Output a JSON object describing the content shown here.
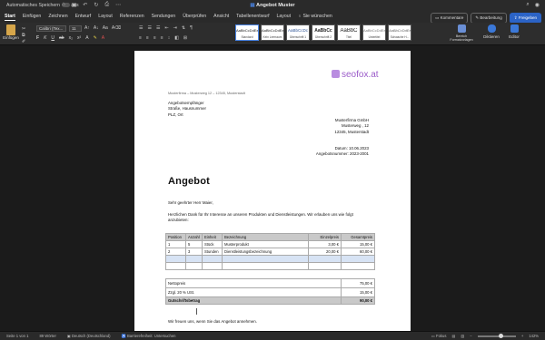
{
  "titlebar": {
    "autosave_label": "Automatisches Speichern",
    "autosave_state": "aus",
    "doc_title": "Angebot Muster",
    "dot_colors": [
      "#ff5f57",
      "#febc2e",
      "#28c840"
    ]
  },
  "tabs": [
    "Start",
    "Einfügen",
    "Zeichnen",
    "Entwurf",
    "Layout",
    "Referenzen",
    "Sendungen",
    "Überprüfen",
    "Ansicht",
    "Tabellenentwurf",
    "Layout",
    "Sie wünschen"
  ],
  "actions": {
    "comments": "Kommentare",
    "editing": "Bearbeitung",
    "share": "Freigeben"
  },
  "ribbon": {
    "paste": "Einfügen",
    "font": "Calibri (Tex...",
    "size": "11",
    "styles": [
      {
        "preview": "AaBbCcDdEe",
        "name": "Standard"
      },
      {
        "preview": "AaBbCcDdEe",
        "name": "Kein Leerraum"
      },
      {
        "preview": "AaBbCcDc",
        "name": "Überschrift 1"
      },
      {
        "preview": "AaBbCc",
        "name": "Überschrift 2"
      },
      {
        "preview": "AaBbC",
        "name": "Titel"
      },
      {
        "preview": "AaBbCcDdEe",
        "name": "Untertitel"
      },
      {
        "preview": "AaBbCcDdEe",
        "name": "Schwache H..."
      }
    ],
    "bereich": "Bereich Formatvorlagen",
    "diktieren": "Diktieren",
    "editor": "Editor",
    "accent": "#2b63c6"
  },
  "document": {
    "logo": "seofox.at",
    "sender_line": "Musterfirma – Musterweg 12 – 12345, Musterstadt",
    "recipient": [
      "Angebotsempfänger",
      "Straße, Hausnummer",
      "PLZ, Ort"
    ],
    "company": [
      "Musterfirma GmbH",
      "Musterweg , 12",
      "12345, Musterstadt"
    ],
    "meta": [
      "Datum: 10.06.2023",
      "Angebotsnummer: 2023-2001"
    ],
    "heading": "Angebot",
    "greeting": "Sehr geehrter Herr Maier,",
    "intro": "Herzlichen Dank für Ihr Interesse an unseren Produkten und Dienstleistungen. Wir erlauben uns wie folgt anzubieten:",
    "table": {
      "headers": [
        "Position",
        "Anzahl",
        "Einheit",
        "Bezeichnung",
        "Einzelpreis",
        "Gesamtpreis"
      ],
      "rows": [
        [
          "1",
          "5",
          "Stück",
          "Musterprodukt",
          "3,00 €",
          "15,00 €"
        ],
        [
          "2",
          "3",
          "Stunden",
          "Dienstleistungsbezeichnung",
          "20,00 €",
          "60,00 €"
        ]
      ],
      "net_label": "Nettopreis",
      "net_value": "75,00 €",
      "vat_label": "Zzgl. 20 % USt.",
      "vat_value": "15,00 €",
      "total_label": "Gutschriftsbetrag",
      "total_value": "90,00 €"
    },
    "outro": "Wir freuen uns, wenn Sie das Angebot annehmen."
  },
  "statusbar": {
    "page": "Seite 1 von 1",
    "words": "89 Wörter",
    "language": "Deutsch (Deutschland)",
    "accessibility": "Barrierefreiheit: Untersuchen",
    "focus": "Fokus",
    "zoom": "142%",
    "zoom_level": 0.62
  }
}
